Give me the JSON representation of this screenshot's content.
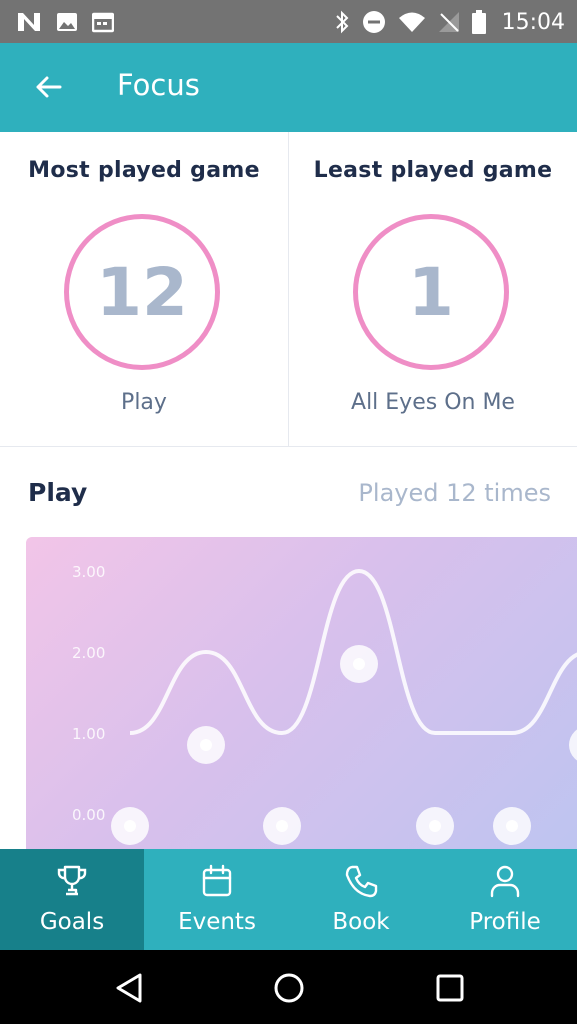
{
  "status_bar": {
    "time": "15:04"
  },
  "app_bar": {
    "title": "Focus"
  },
  "stats": {
    "most": {
      "heading": "Most played game",
      "count": "12",
      "name": "Play"
    },
    "least": {
      "heading": "Least played game",
      "count": "1",
      "name": "All Eyes On Me"
    }
  },
  "section": {
    "title": "Play",
    "subtitle": "Played 12 times"
  },
  "chart_data": {
    "type": "line",
    "ylim": [
      0,
      3
    ],
    "y_ticks": [
      "0.00",
      "1.00",
      "2.00",
      "3.00"
    ],
    "series": [
      {
        "values": [
          1,
          2,
          1,
          3,
          1,
          1,
          2
        ]
      }
    ],
    "points": [
      0,
      1,
      0,
      2,
      0,
      0,
      1
    ],
    "colors": {
      "line": "#ffffff",
      "grad_start": "#f2c5e8",
      "grad_end": "#bec4f0"
    }
  },
  "tabs": [
    {
      "label": "Goals",
      "icon": "trophy-icon",
      "active": true
    },
    {
      "label": "Events",
      "icon": "calendar-icon",
      "active": false
    },
    {
      "label": "Book",
      "icon": "phone-icon",
      "active": false
    },
    {
      "label": "Profile",
      "icon": "person-icon",
      "active": false
    }
  ]
}
